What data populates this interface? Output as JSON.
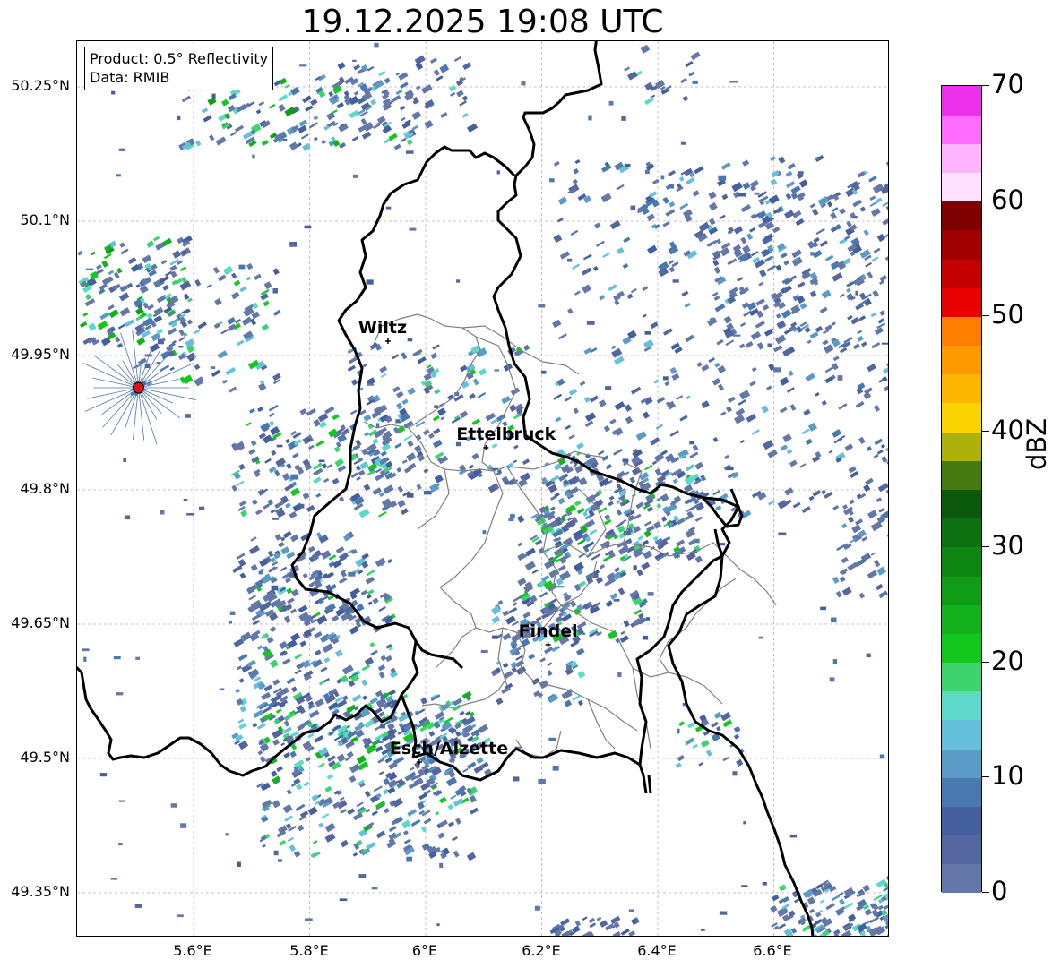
{
  "title": "19.12.2025 19:08 UTC",
  "info": {
    "product": "Product: 0.5° Reflectivity",
    "source": "Data: RMIB"
  },
  "axes": {
    "y_ticks": [
      "50.25°N",
      "50.1°N",
      "49.95°N",
      "49.8°N",
      "49.65°N",
      "49.5°N",
      "49.35°N"
    ],
    "x_ticks": [
      "5.6°E",
      "5.8°E",
      "6°E",
      "6.2°E",
      "6.4°E",
      "6.6°E"
    ],
    "gridlines": true
  },
  "cities": [
    {
      "name": "Wiltz",
      "lon": 5.935,
      "lat": 49.966
    },
    {
      "name": "Ettelbruck",
      "lon": 6.104,
      "lat": 49.847
    },
    {
      "name": "Findel",
      "lon": 6.211,
      "lat": 49.627
    },
    {
      "name": "Esch/Alzette",
      "lon": 5.989,
      "lat": 49.496
    }
  ],
  "radar_site": {
    "lon": 5.505,
    "lat": 49.914,
    "marker_color": "#dd1111"
  },
  "colorbar": {
    "label": "dBZ",
    "ticks": [
      "0",
      "10",
      "20",
      "30",
      "40",
      "50",
      "60",
      "70"
    ],
    "min": 0,
    "max": 70,
    "colors": [
      "#6477a9",
      "#5366a0",
      "#445f9e",
      "#4a78b0",
      "#5b9bc8",
      "#65c0dc",
      "#5ed8c8",
      "#3dd46e",
      "#13c81d",
      "#11b21b",
      "#0f9c17",
      "#0e8712",
      "#0d700e",
      "#0b5a0b",
      "#447a10",
      "#adb10a",
      "#fbd400",
      "#fdb600",
      "#fe9a00",
      "#fe7e00",
      "#e60000",
      "#c40000",
      "#a20000",
      "#7e0000",
      "#ffe0ff",
      "#ffb4ff",
      "#ff6cff",
      "#ec30ec"
    ]
  },
  "map_colors": {
    "border": "#000000",
    "cantons": "#808080",
    "grid": "#b4b4b4"
  }
}
